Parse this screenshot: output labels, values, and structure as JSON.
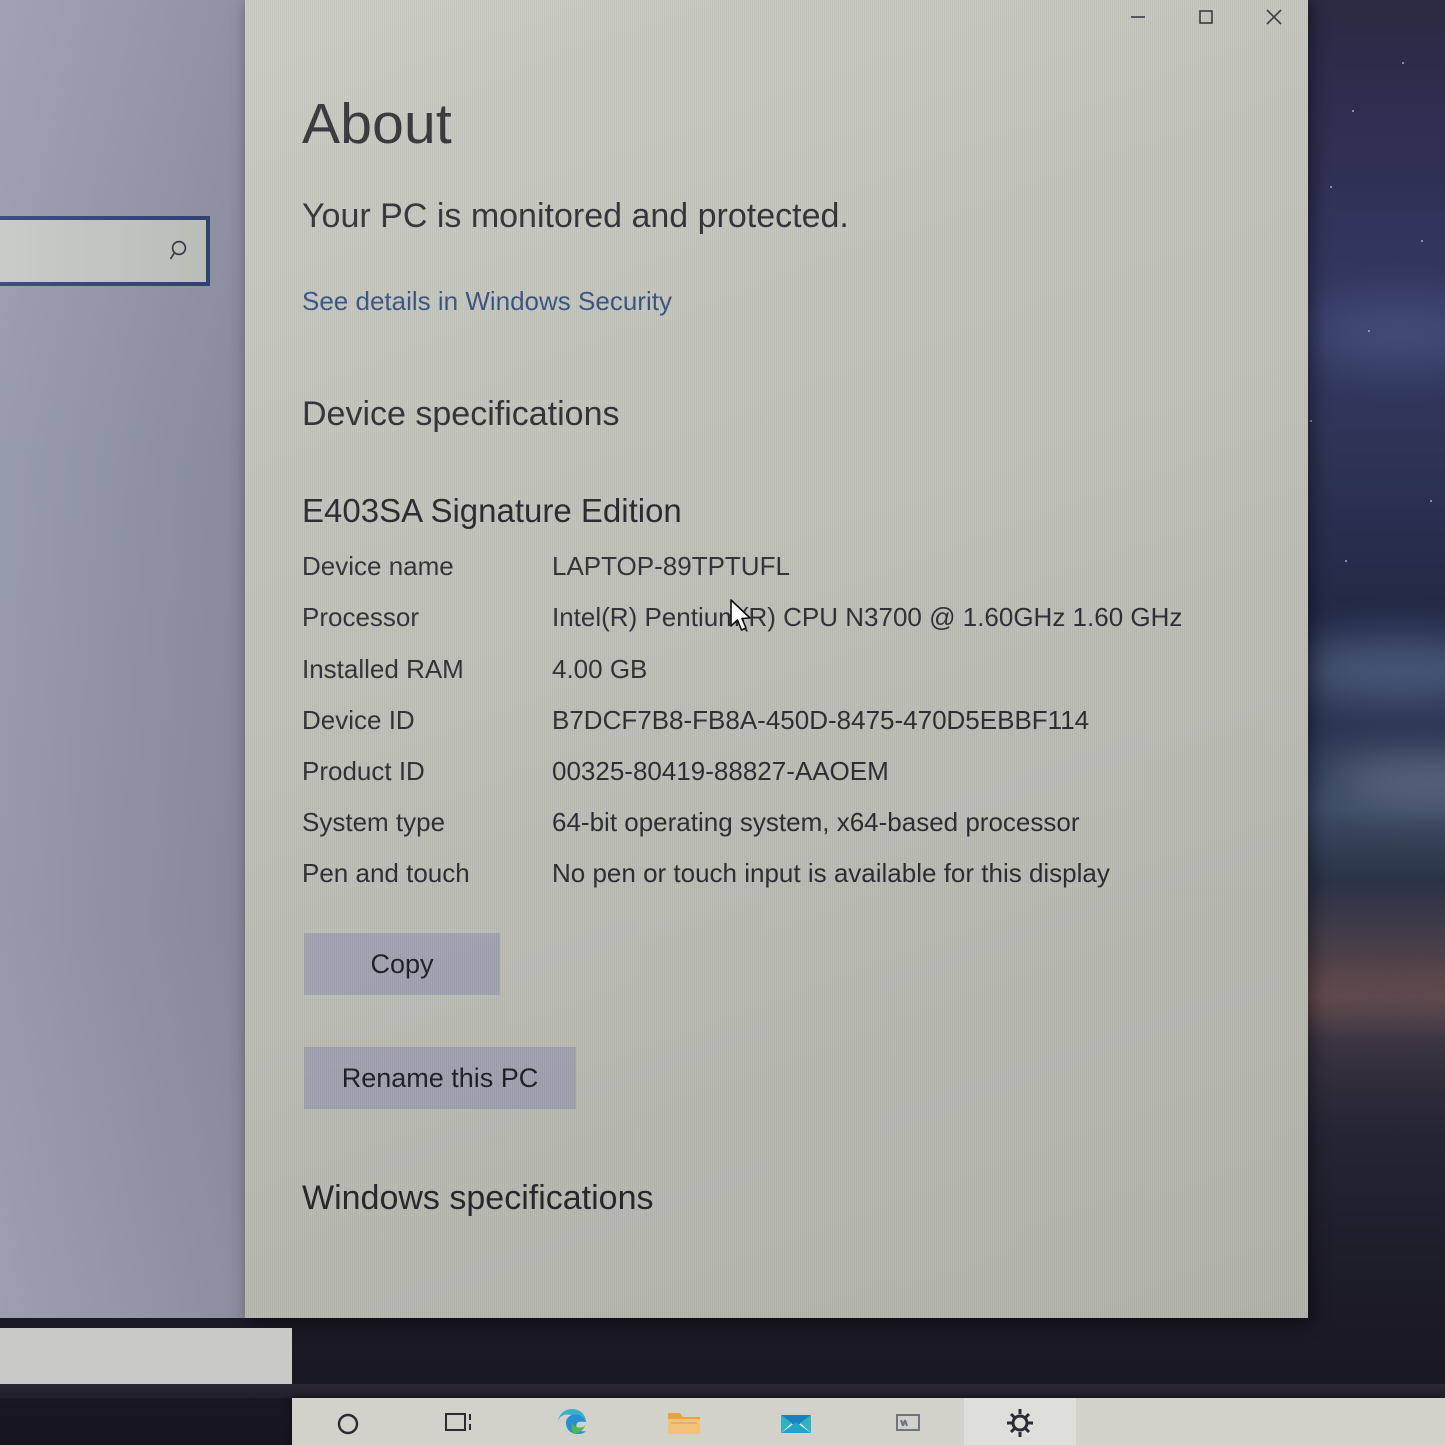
{
  "window": {
    "title": "About",
    "controls": {
      "minimize": "Minimize",
      "maximize": "Maximize",
      "close": "Close"
    }
  },
  "sidebar": {
    "search": {
      "value": "",
      "placeholder": "",
      "icon": "search-icon"
    }
  },
  "about": {
    "heading": "About",
    "protection_status": "Your PC is monitored and protected.",
    "security_link": "See details in Windows Security",
    "device_specs_heading": "Device specifications",
    "device_model": "E403SA Signature Edition",
    "specs": [
      {
        "label": "Device name",
        "value": "LAPTOP-89TPTUFL"
      },
      {
        "label": "Processor",
        "value": "Intel(R) Pentium(R) CPU  N3700  @ 1.60GHz   1.60 GHz"
      },
      {
        "label": "Installed RAM",
        "value": "4.00 GB"
      },
      {
        "label": "Device ID",
        "value": "B7DCF7B8-FB8A-450D-8475-470D5EBBF114"
      },
      {
        "label": "Product ID",
        "value": "00325-80419-88827-AAOEM"
      },
      {
        "label": "System type",
        "value": "64-bit operating system, x64-based processor"
      },
      {
        "label": "Pen and touch",
        "value": "No pen or touch input is available for this display"
      }
    ],
    "copy_button": "Copy",
    "rename_button": "Rename this PC",
    "windows_specs_heading": "Windows specifications"
  },
  "taskbar": {
    "items": [
      {
        "name": "search-icon",
        "label": "Search"
      },
      {
        "name": "task-view-icon",
        "label": "Task View"
      },
      {
        "name": "edge-browser-icon",
        "label": "Microsoft Edge"
      },
      {
        "name": "file-explorer-icon",
        "label": "File Explorer"
      },
      {
        "name": "mail-icon",
        "label": "Mail"
      },
      {
        "name": "word-icon",
        "label": "Word"
      },
      {
        "name": "settings-gear-icon",
        "label": "Settings"
      }
    ]
  },
  "colors": {
    "window_background": "#c4c6bd",
    "sidebar_background": "#9195a9",
    "link": "#2c4a7c",
    "button_background": "#a7abb9",
    "text": "#25262b",
    "taskbar": "#d2d2cb"
  }
}
